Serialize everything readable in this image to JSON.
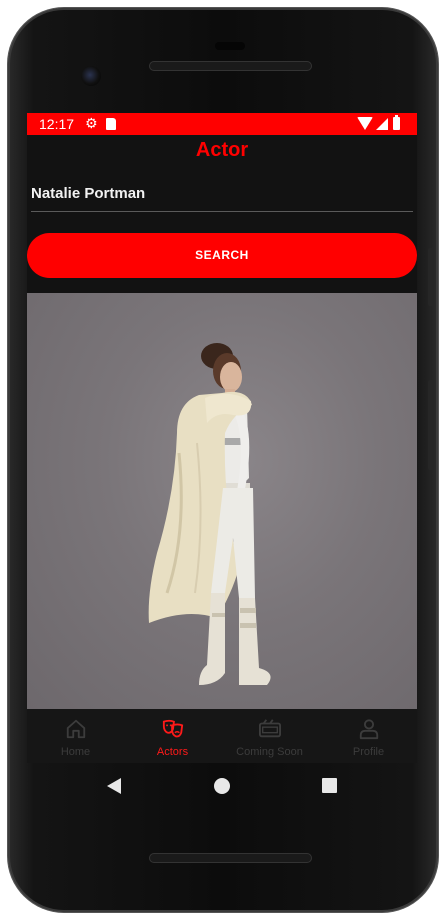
{
  "status_bar": {
    "time": "12:17",
    "icons": [
      "gear-icon",
      "sd-card-icon",
      "wifi-icon",
      "signal-icon",
      "battery-icon"
    ]
  },
  "header": {
    "title": "Actor"
  },
  "search": {
    "value": "Natalie Portman",
    "button_label": "SEARCH"
  },
  "result": {
    "image": "actor-photo"
  },
  "bottom_nav": {
    "items": [
      {
        "label": "Home",
        "icon": "home-icon",
        "active": false
      },
      {
        "label": "Actors",
        "icon": "theater-masks-icon",
        "active": true
      },
      {
        "label": "Coming Soon",
        "icon": "cinema-ticket-icon",
        "active": false
      },
      {
        "label": "Profile",
        "icon": "person-icon",
        "active": false
      }
    ]
  },
  "colors": {
    "accent": "#ff0000",
    "background": "#121212",
    "nav_inactive": "#3c3c3c"
  }
}
